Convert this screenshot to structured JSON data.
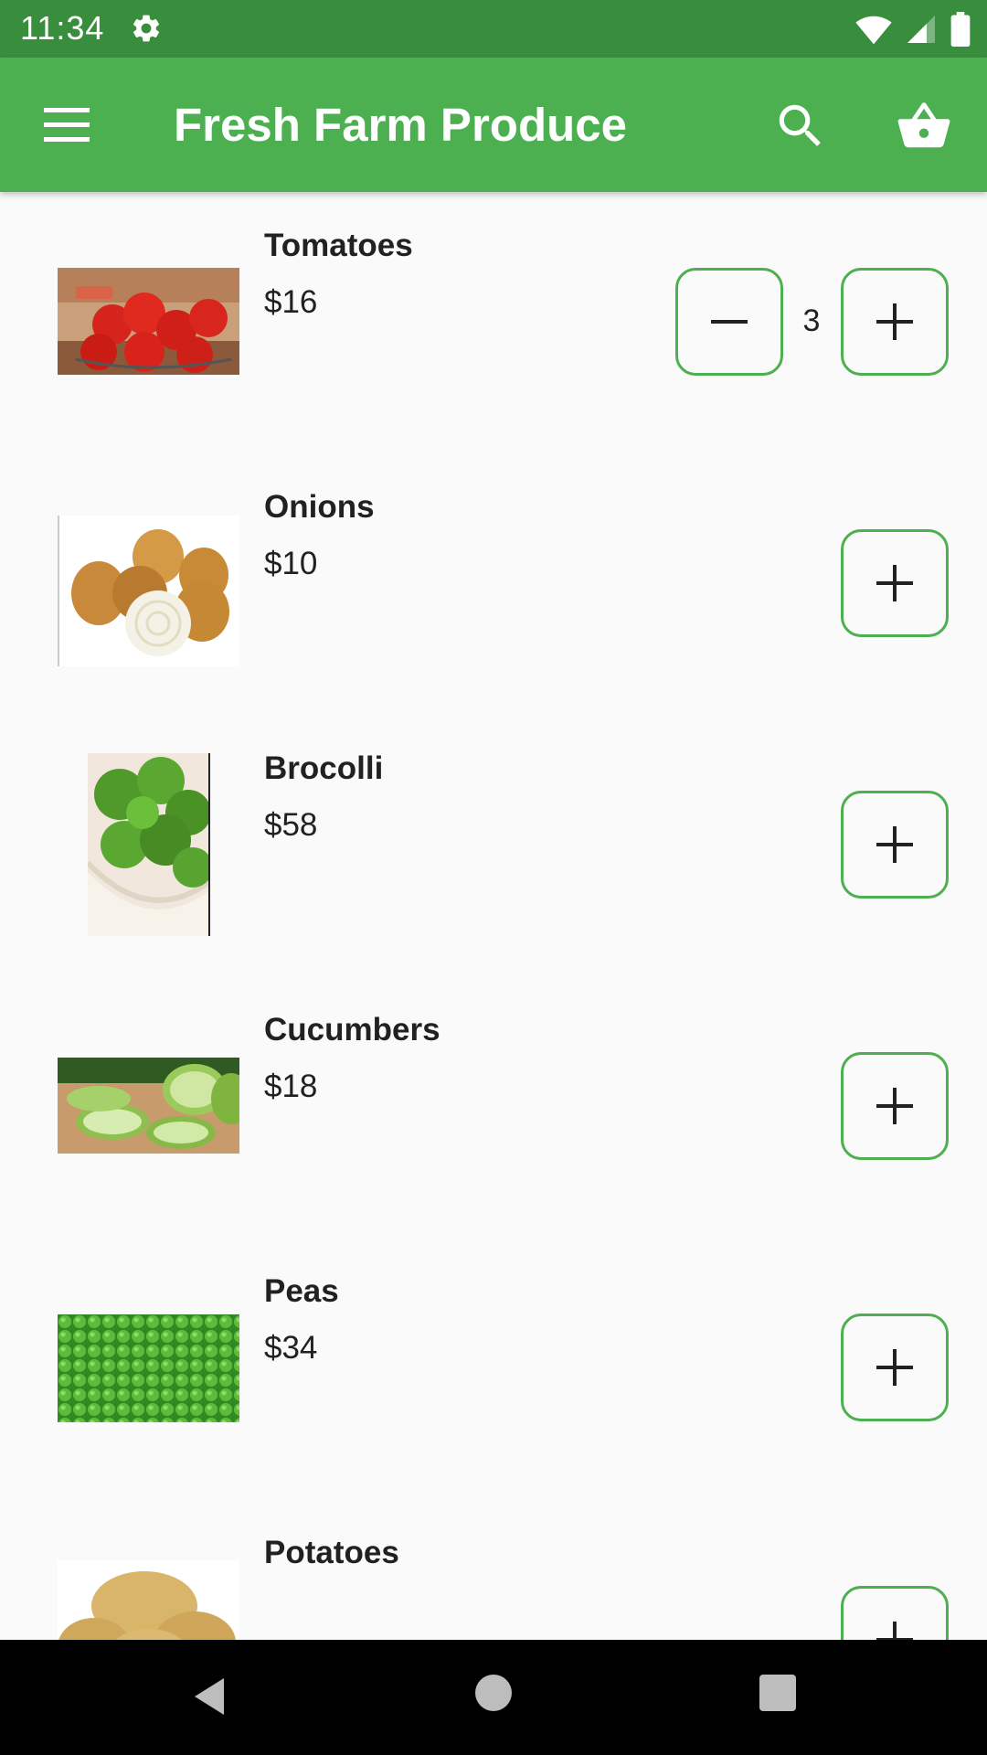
{
  "status_bar": {
    "time": "11:34",
    "icons": [
      "settings-icon",
      "wifi-icon",
      "signal-icon",
      "battery-icon"
    ]
  },
  "app_bar": {
    "title": "Fresh Farm Produce",
    "icons": [
      "menu-icon",
      "search-icon",
      "shopping-basket-icon"
    ]
  },
  "colors": {
    "primary": "#4caf50",
    "primary_dark": "#388e3c",
    "background": "#fafafa",
    "text": "#212121"
  },
  "products": [
    {
      "name": "Tomatoes",
      "price": "$16",
      "quantity": "3"
    },
    {
      "name": "Onions",
      "price": "$10"
    },
    {
      "name": "Brocolli",
      "price": "$58"
    },
    {
      "name": "Cucumbers",
      "price": "$18"
    },
    {
      "name": "Peas",
      "price": "$34"
    },
    {
      "name": "Potatoes"
    }
  ],
  "nav_bar": {
    "icons": [
      "back-icon",
      "home-icon",
      "recents-icon"
    ]
  }
}
